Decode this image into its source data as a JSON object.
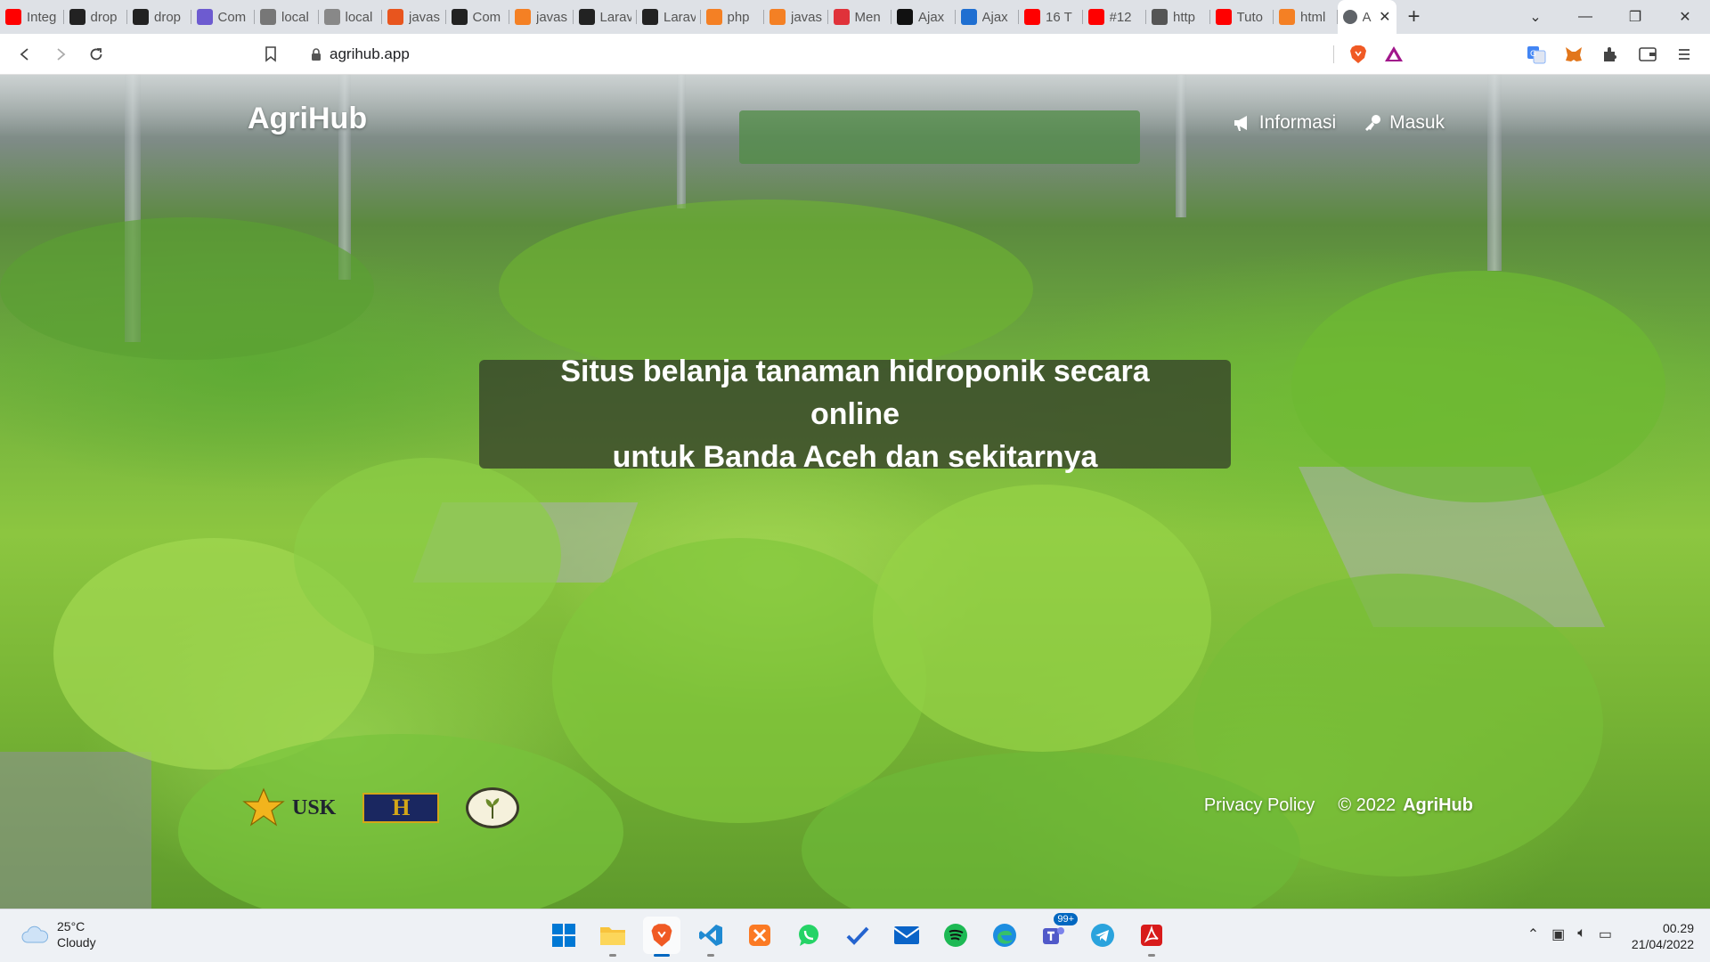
{
  "browser": {
    "tabs": [
      {
        "title": "Integ",
        "icon": "youtube-icon",
        "color": "#ff0000"
      },
      {
        "title": "drop",
        "icon": "github-icon",
        "color": "#222222"
      },
      {
        "title": "drop",
        "icon": "github-icon",
        "color": "#222222"
      },
      {
        "title": "Com",
        "icon": "discord-icon",
        "color": "#6d5bd0"
      },
      {
        "title": "local",
        "icon": "pen-icon",
        "color": "#777777"
      },
      {
        "title": "local",
        "icon": "chart-icon",
        "color": "#888888"
      },
      {
        "title": "javas",
        "icon": "code-icon",
        "color": "#e8551e"
      },
      {
        "title": "Com",
        "icon": "github-icon",
        "color": "#222222"
      },
      {
        "title": "javas",
        "icon": "stackoverflow-icon",
        "color": "#f48024"
      },
      {
        "title": "Larav",
        "icon": "tm-icon",
        "color": "#222222"
      },
      {
        "title": "Larav",
        "icon": "tm-icon",
        "color": "#222222"
      },
      {
        "title": "php",
        "icon": "stackoverflow-icon",
        "color": "#f48024"
      },
      {
        "title": "javas",
        "icon": "stackoverflow-icon",
        "color": "#f48024"
      },
      {
        "title": "Men",
        "icon": "qa-icon",
        "color": "#e0323a"
      },
      {
        "title": "Ajax",
        "icon": "globe-dark-icon",
        "color": "#111111"
      },
      {
        "title": "Ajax",
        "icon": "st-icon",
        "color": "#1f6fd1"
      },
      {
        "title": "16 T",
        "icon": "youtube-icon",
        "color": "#ff0000"
      },
      {
        "title": "#12",
        "icon": "youtube-icon",
        "color": "#ff0000"
      },
      {
        "title": "http",
        "icon": "page-icon",
        "color": "#555555"
      },
      {
        "title": "Tuto",
        "icon": "youtube-icon",
        "color": "#ff0000"
      },
      {
        "title": "html",
        "icon": "stackoverflow-icon",
        "color": "#f48024"
      }
    ],
    "active_tab": {
      "title": "A",
      "icon": "globe-icon"
    },
    "address": "agrihub.app"
  },
  "site": {
    "brand": "AgriHub",
    "nav": [
      {
        "label": "Informasi",
        "icon": "megaphone-icon"
      },
      {
        "label": "Masuk",
        "icon": "key-icon"
      }
    ],
    "tagline_line1": "Situs belanja tanaman hidroponik secara online",
    "tagline_line2": "untuk Banda Aceh dan sekitarnya",
    "footer": {
      "privacy": "Privacy Policy",
      "copyright": "© 2022",
      "copyright_brand": "AgriHub"
    },
    "logos": [
      {
        "name": "usk-logo",
        "text": "USK"
      },
      {
        "name": "partner-logo",
        "text": "H"
      },
      {
        "name": "seal-logo",
        "text": ""
      }
    ]
  },
  "taskbar": {
    "weather_temp": "25°C",
    "weather_desc": "Cloudy",
    "time": "00.29",
    "date": "21/04/2022",
    "apps": [
      {
        "name": "start-icon"
      },
      {
        "name": "file-explorer-icon"
      },
      {
        "name": "brave-browser-icon",
        "active": true
      },
      {
        "name": "vscode-icon"
      },
      {
        "name": "xampp-icon"
      },
      {
        "name": "whatsapp-icon"
      },
      {
        "name": "todo-icon"
      },
      {
        "name": "mail-icon"
      },
      {
        "name": "spotify-icon"
      },
      {
        "name": "edge-icon"
      },
      {
        "name": "teams-icon",
        "badge": "99+"
      },
      {
        "name": "telegram-icon"
      },
      {
        "name": "acrobat-icon"
      }
    ]
  },
  "colors": {
    "tagline_bg": "#303828",
    "accent": "#0067c0"
  }
}
